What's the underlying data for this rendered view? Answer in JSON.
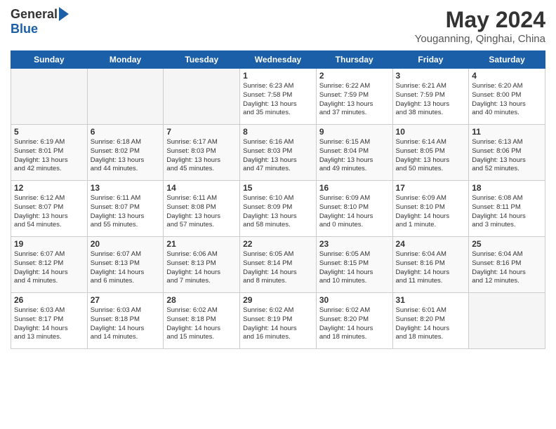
{
  "header": {
    "logo_general": "General",
    "logo_blue": "Blue",
    "month_title": "May 2024",
    "location": "Youganning, Qinghai, China"
  },
  "weekdays": [
    "Sunday",
    "Monday",
    "Tuesday",
    "Wednesday",
    "Thursday",
    "Friday",
    "Saturday"
  ],
  "weeks": [
    [
      {
        "day": "",
        "info": ""
      },
      {
        "day": "",
        "info": ""
      },
      {
        "day": "",
        "info": ""
      },
      {
        "day": "1",
        "info": "Sunrise: 6:23 AM\nSunset: 7:58 PM\nDaylight: 13 hours\nand 35 minutes."
      },
      {
        "day": "2",
        "info": "Sunrise: 6:22 AM\nSunset: 7:59 PM\nDaylight: 13 hours\nand 37 minutes."
      },
      {
        "day": "3",
        "info": "Sunrise: 6:21 AM\nSunset: 7:59 PM\nDaylight: 13 hours\nand 38 minutes."
      },
      {
        "day": "4",
        "info": "Sunrise: 6:20 AM\nSunset: 8:00 PM\nDaylight: 13 hours\nand 40 minutes."
      }
    ],
    [
      {
        "day": "5",
        "info": "Sunrise: 6:19 AM\nSunset: 8:01 PM\nDaylight: 13 hours\nand 42 minutes."
      },
      {
        "day": "6",
        "info": "Sunrise: 6:18 AM\nSunset: 8:02 PM\nDaylight: 13 hours\nand 44 minutes."
      },
      {
        "day": "7",
        "info": "Sunrise: 6:17 AM\nSunset: 8:03 PM\nDaylight: 13 hours\nand 45 minutes."
      },
      {
        "day": "8",
        "info": "Sunrise: 6:16 AM\nSunset: 8:03 PM\nDaylight: 13 hours\nand 47 minutes."
      },
      {
        "day": "9",
        "info": "Sunrise: 6:15 AM\nSunset: 8:04 PM\nDaylight: 13 hours\nand 49 minutes."
      },
      {
        "day": "10",
        "info": "Sunrise: 6:14 AM\nSunset: 8:05 PM\nDaylight: 13 hours\nand 50 minutes."
      },
      {
        "day": "11",
        "info": "Sunrise: 6:13 AM\nSunset: 8:06 PM\nDaylight: 13 hours\nand 52 minutes."
      }
    ],
    [
      {
        "day": "12",
        "info": "Sunrise: 6:12 AM\nSunset: 8:07 PM\nDaylight: 13 hours\nand 54 minutes."
      },
      {
        "day": "13",
        "info": "Sunrise: 6:11 AM\nSunset: 8:07 PM\nDaylight: 13 hours\nand 55 minutes."
      },
      {
        "day": "14",
        "info": "Sunrise: 6:11 AM\nSunset: 8:08 PM\nDaylight: 13 hours\nand 57 minutes."
      },
      {
        "day": "15",
        "info": "Sunrise: 6:10 AM\nSunset: 8:09 PM\nDaylight: 13 hours\nand 58 minutes."
      },
      {
        "day": "16",
        "info": "Sunrise: 6:09 AM\nSunset: 8:10 PM\nDaylight: 14 hours\nand 0 minutes."
      },
      {
        "day": "17",
        "info": "Sunrise: 6:09 AM\nSunset: 8:10 PM\nDaylight: 14 hours\nand 1 minute."
      },
      {
        "day": "18",
        "info": "Sunrise: 6:08 AM\nSunset: 8:11 PM\nDaylight: 14 hours\nand 3 minutes."
      }
    ],
    [
      {
        "day": "19",
        "info": "Sunrise: 6:07 AM\nSunset: 8:12 PM\nDaylight: 14 hours\nand 4 minutes."
      },
      {
        "day": "20",
        "info": "Sunrise: 6:07 AM\nSunset: 8:13 PM\nDaylight: 14 hours\nand 6 minutes."
      },
      {
        "day": "21",
        "info": "Sunrise: 6:06 AM\nSunset: 8:13 PM\nDaylight: 14 hours\nand 7 minutes."
      },
      {
        "day": "22",
        "info": "Sunrise: 6:05 AM\nSunset: 8:14 PM\nDaylight: 14 hours\nand 8 minutes."
      },
      {
        "day": "23",
        "info": "Sunrise: 6:05 AM\nSunset: 8:15 PM\nDaylight: 14 hours\nand 10 minutes."
      },
      {
        "day": "24",
        "info": "Sunrise: 6:04 AM\nSunset: 8:16 PM\nDaylight: 14 hours\nand 11 minutes."
      },
      {
        "day": "25",
        "info": "Sunrise: 6:04 AM\nSunset: 8:16 PM\nDaylight: 14 hours\nand 12 minutes."
      }
    ],
    [
      {
        "day": "26",
        "info": "Sunrise: 6:03 AM\nSunset: 8:17 PM\nDaylight: 14 hours\nand 13 minutes."
      },
      {
        "day": "27",
        "info": "Sunrise: 6:03 AM\nSunset: 8:18 PM\nDaylight: 14 hours\nand 14 minutes."
      },
      {
        "day": "28",
        "info": "Sunrise: 6:02 AM\nSunset: 8:18 PM\nDaylight: 14 hours\nand 15 minutes."
      },
      {
        "day": "29",
        "info": "Sunrise: 6:02 AM\nSunset: 8:19 PM\nDaylight: 14 hours\nand 16 minutes."
      },
      {
        "day": "30",
        "info": "Sunrise: 6:02 AM\nSunset: 8:20 PM\nDaylight: 14 hours\nand 18 minutes."
      },
      {
        "day": "31",
        "info": "Sunrise: 6:01 AM\nSunset: 8:20 PM\nDaylight: 14 hours\nand 18 minutes."
      },
      {
        "day": "",
        "info": ""
      }
    ]
  ]
}
